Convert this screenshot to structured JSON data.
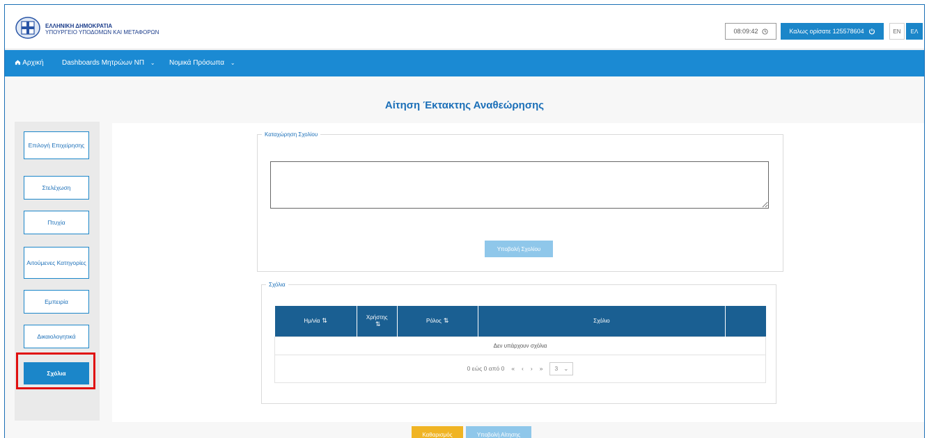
{
  "header": {
    "org_line1": "ΕΛΛΗΝΙΚΗ ΔΗΜΟΚΡΑΤΙΑ",
    "org_line2": "ΥΠΟΥΡΓΕΙΟ ΥΠΟΔΟΜΩΝ ΚΑΙ ΜΕΤΑΦΟΡΩΝ",
    "timer": "08:09:42",
    "timer_icon": "clock-icon",
    "welcome": "Καλως ορίσατε 125578604",
    "logout_icon": "power-icon",
    "lang_en": "EN",
    "lang_el": "ΕΛ"
  },
  "nav": {
    "home": "Αρχική",
    "home_icon": "home-icon",
    "dashboards": "Dashboards Μητρώων ΝΠ",
    "legal_entities": "Νομικά Πρόσωπα"
  },
  "page_title": "Αίτηση Έκτακτης Αναθεώρησης",
  "sidebar": {
    "items": [
      {
        "label": "Επιλογή Επιχείρησης"
      },
      {
        "label": "Στελέχωση"
      },
      {
        "label": "Πτυχία"
      },
      {
        "label": "Αιτούμενες Κατηγορίες"
      },
      {
        "label": "Εμπειρία"
      },
      {
        "label": "Δικαιολογητικά"
      },
      {
        "label": "Σχόλια"
      }
    ]
  },
  "comment_entry": {
    "legend": "Καταχώρηση Σχολίου",
    "value": "",
    "submit_label": "Υποβολή Σχολίου"
  },
  "comments": {
    "legend": "Σχόλια",
    "columns": [
      "Ημ/νία",
      "Χρήστης",
      "Ρόλος",
      "Σχόλιο"
    ],
    "empty_message": "Δεν υπάρχουν σχόλια",
    "pager_text": "0 εώς 0 από 0",
    "rows_per_page": "3"
  },
  "actions": {
    "clear_label": "Καθαρισμός",
    "submit_label": "Υποβολή Αίτησης"
  },
  "colors": {
    "primary": "#1b86c9",
    "table_header": "#1a5f92",
    "warning": "#f0b424",
    "highlight": "#e01010"
  }
}
